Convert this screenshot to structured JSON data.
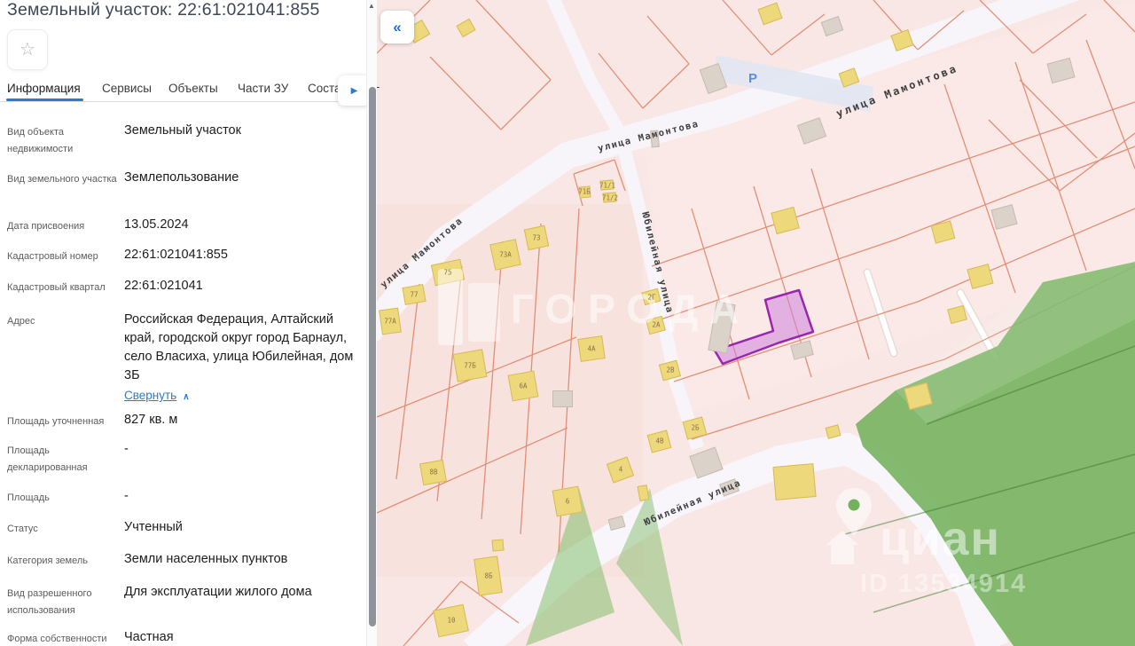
{
  "panel": {
    "title": "Земельный участок: 22:61:021041:855",
    "star_icon": "☆",
    "tabs": [
      {
        "label": "Информация"
      },
      {
        "label": "Сервисы"
      },
      {
        "label": "Объекты"
      },
      {
        "label": "Части ЗУ"
      },
      {
        "label": "Соста"
      }
    ],
    "tabs_more_icon": "▶",
    "tab_overflow": "Г",
    "scroll_up_icon": "▲",
    "accent_color": "#2b7bd2",
    "fields": [
      {
        "label": "Вид объекта недвижимости",
        "value": "Земельный участок"
      },
      {
        "label": "Вид земельного участка",
        "value": "Землепользование"
      },
      {
        "label": "Дата присвоения",
        "value": "13.05.2024"
      },
      {
        "label": "Кадастровый номер",
        "value": "22:61:021041:855"
      },
      {
        "label": "Кадастровый квартал",
        "value": "22:61:021041"
      },
      {
        "label": "Адрес",
        "value": "Российская Федерация, Алтайский край, городской округ город Барнаул, село Власиха, улица Юбилейная, дом 3Б"
      },
      {
        "label": "Площадь уточненная",
        "value": "827 кв. м"
      },
      {
        "label": "Площадь декларированная",
        "value": "-"
      },
      {
        "label": "Площадь",
        "value": "-"
      },
      {
        "label": "Статус",
        "value": "Учтенный"
      },
      {
        "label": "Категория земель",
        "value": "Земли населенных пунктов"
      },
      {
        "label": "Вид разрешенного использования",
        "value": "Для эксплуатации жилого дома"
      },
      {
        "label": "Форма собственности",
        "value": "Частная"
      }
    ],
    "address_collapse": {
      "label": "Свернуть",
      "icon": "∧"
    }
  },
  "map": {
    "collapse_icon": "«",
    "parking_label": "Р",
    "streets": {
      "mamontova": "улица Мамонтова",
      "yubileynaya": "Юбилейная улица"
    },
    "buildings": [
      "75",
      "73А",
      "73",
      "77",
      "77А",
      "77Б",
      "71Б",
      "71/1",
      "71/2",
      "6А",
      "4А",
      "2Г",
      "2А",
      "2В",
      "2Б",
      "4В",
      "4",
      "8В",
      "6",
      "8Б",
      "10"
    ],
    "watermarks": {
      "provider": "ГОРОДА",
      "brand": "циан",
      "id": "ID 13534914"
    },
    "highlight_color": "#9c27b0",
    "green_area_color": "#72b25c"
  }
}
